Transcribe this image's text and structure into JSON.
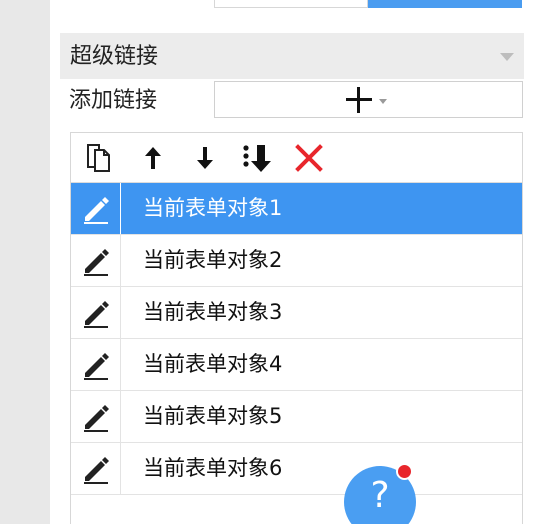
{
  "section": {
    "title": "超级链接"
  },
  "add_link": {
    "label": "添加链接"
  },
  "toolbar": {
    "icons": [
      "copy-icon",
      "arrow-up-icon",
      "arrow-down-icon",
      "move-to-bottom-icon",
      "delete-icon"
    ]
  },
  "links": [
    {
      "label": "当前表单对象1",
      "selected": true
    },
    {
      "label": "当前表单对象2",
      "selected": false
    },
    {
      "label": "当前表单对象3",
      "selected": false
    },
    {
      "label": "当前表单对象4",
      "selected": false
    },
    {
      "label": "当前表单对象5",
      "selected": false
    },
    {
      "label": "当前表单对象6",
      "selected": false
    }
  ],
  "help": {
    "symbol": "?"
  },
  "colors": {
    "selected_row": "#3e95f1",
    "help_button": "#4a9ef2",
    "delete": "#e8262c",
    "notification_dot": "#e8262c"
  }
}
